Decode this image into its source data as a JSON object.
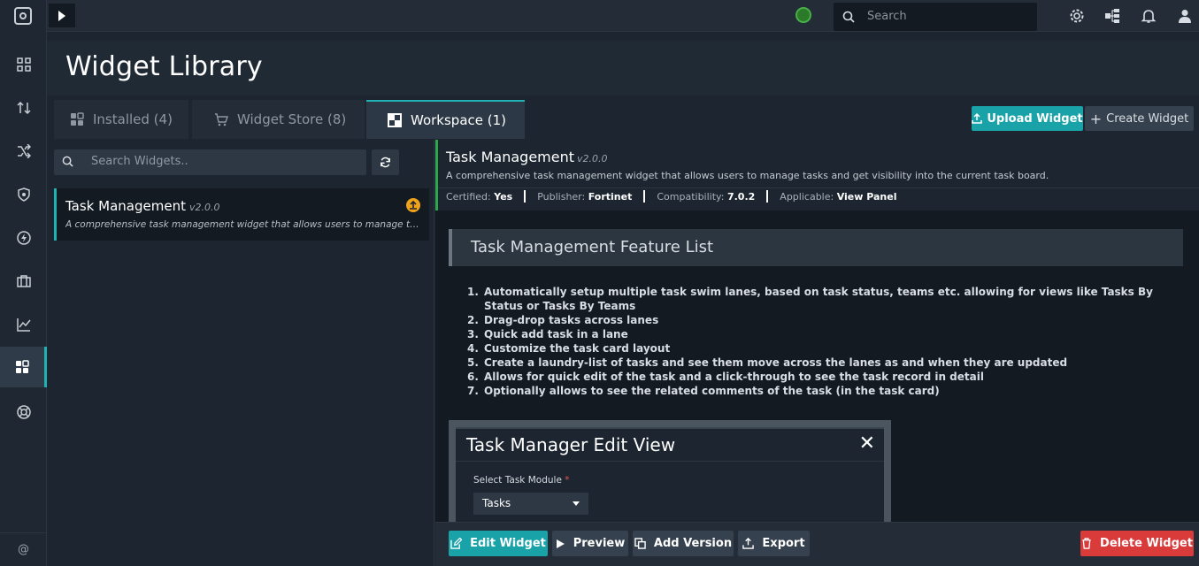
{
  "topbar": {
    "search_placeholder": "Search"
  },
  "page": {
    "title": "Widget Library"
  },
  "tabs": [
    {
      "label": "Installed (4)",
      "icon": "grid-icon"
    },
    {
      "label": "Widget Store (8)",
      "icon": "cart-icon"
    },
    {
      "label": "Workspace (1)",
      "icon": "workspace-icon"
    }
  ],
  "actions": {
    "upload_label": "Upload Widget",
    "create_label": "Create Widget"
  },
  "list": {
    "search_placeholder": "Search Widgets..",
    "items": [
      {
        "name": "Task Management",
        "version": "v2.0.0",
        "description": "A comprehensive task management widget that allows users to manage tasks and get visibility into the current task board."
      }
    ]
  },
  "detail": {
    "name": "Task Management",
    "version": "v2.0.0",
    "description": "A comprehensive task management widget that allows users to manage tasks and get visibility into the current task board.",
    "meta": {
      "certified_label": "Certified:",
      "certified_value": "Yes",
      "publisher_label": "Publisher:",
      "publisher_value": "Fortinet",
      "compatibility_label": "Compatibility:",
      "compatibility_value": "7.0.2",
      "applicable_label": "Applicable:",
      "applicable_value": "View Panel"
    },
    "feature_heading": "Task Management Feature List",
    "features": [
      "Automatically setup multiple task swim lanes, based on task status, teams etc. allowing for views like Tasks By Status or Tasks By Teams",
      "Drag-drop tasks across lanes",
      "Quick add task in a lane",
      "Customize the task card layout",
      "Create a laundry-list of tasks and see them move across the lanes as and when they are updated",
      "Allows for quick edit of the task and a click-through to see the task record in detail",
      "Optionally allows to see the related comments of the task (in the task card)"
    ],
    "preview": {
      "title": "Task Manager Edit View",
      "close": "✕",
      "field_label": "Select Task Module",
      "required_mark": "*",
      "selected_value": "Tasks"
    }
  },
  "bottom_actions": {
    "edit_label": "Edit Widget",
    "preview_label": "Preview",
    "add_version_label": "Add Version",
    "export_label": "Export",
    "delete_label": "Delete Widget"
  },
  "footer": {
    "at_symbol": "@"
  },
  "colors": {
    "accent": "#1aa2a9",
    "danger": "#d93b3b",
    "status_green": "#47b047",
    "update_badge": "#f0a21b"
  }
}
